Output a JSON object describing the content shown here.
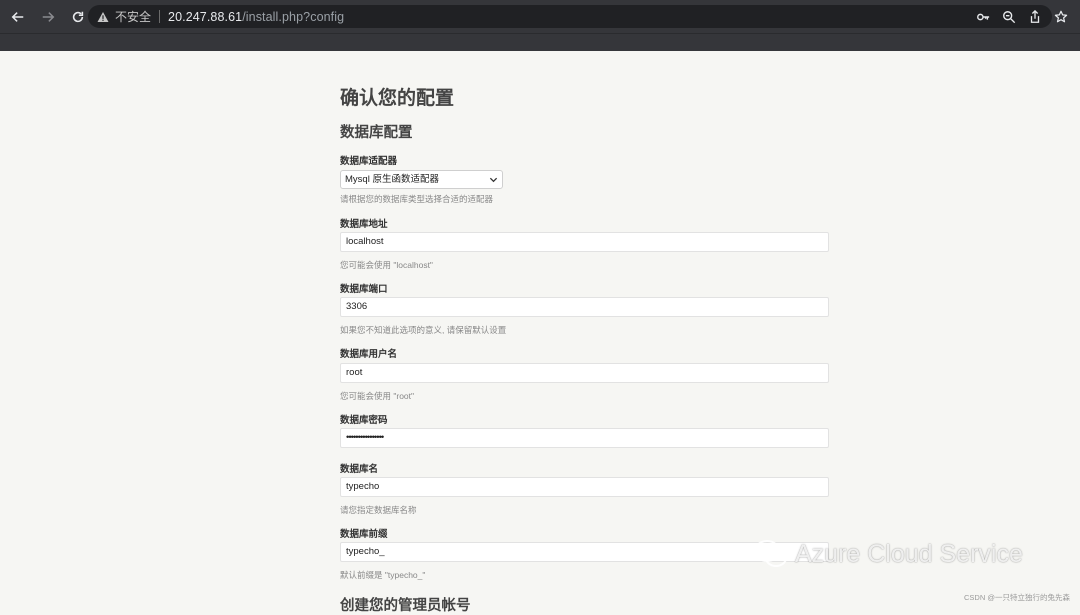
{
  "browser": {
    "security_label": "不安全",
    "url_host": "20.247.88.61",
    "url_path": "/install.php?config"
  },
  "page": {
    "title": "确认您的配置",
    "db_section_title": "数据库配置",
    "admin_section_title": "创建您的管理员帐号"
  },
  "db": {
    "adapter": {
      "label": "数据库适配器",
      "value": "Mysql 原生函数适配器",
      "hint": "请根据您的数据库类型选择合适的适配器"
    },
    "host": {
      "label": "数据库地址",
      "value": "localhost",
      "hint": "您可能会使用 \"localhost\""
    },
    "port": {
      "label": "数据库端口",
      "value": "3306",
      "hint": "如果您不知道此选项的意义, 请保留默认设置"
    },
    "user": {
      "label": "数据库用户名",
      "value": "root",
      "hint": "您可能会使用 \"root\""
    },
    "password": {
      "label": "数据库密码",
      "value": "••••••••••••••••"
    },
    "name": {
      "label": "数据库名",
      "value": "typecho",
      "hint": "请您指定数据库名称"
    },
    "prefix": {
      "label": "数据库前缀",
      "value": "typecho_",
      "hint": "默认前缀是 \"typecho_\""
    }
  },
  "watermark": {
    "text": "Azure Cloud Service",
    "source": "CSDN @一只特立独行的兔先森"
  }
}
